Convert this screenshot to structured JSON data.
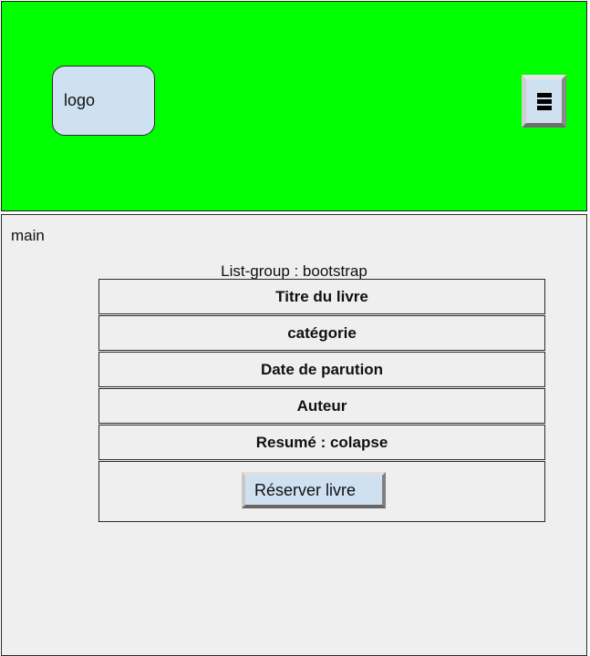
{
  "colors": {
    "header_bg": "#00ff00",
    "main_bg": "#efefef",
    "control_bg": "#cfe0f1"
  },
  "header": {
    "logo_label": "logo",
    "menu_icon": "hamburger-menu-icon"
  },
  "main": {
    "label": "main",
    "list_group_caption": "List-group : bootstrap",
    "items": [
      {
        "label": "Titre du livre"
      },
      {
        "label": "catégorie"
      },
      {
        "label": "Date de parution"
      },
      {
        "label": "Auteur"
      },
      {
        "label": "Resumé : colapse"
      }
    ],
    "reserve_button_label": "Réserver livre"
  }
}
